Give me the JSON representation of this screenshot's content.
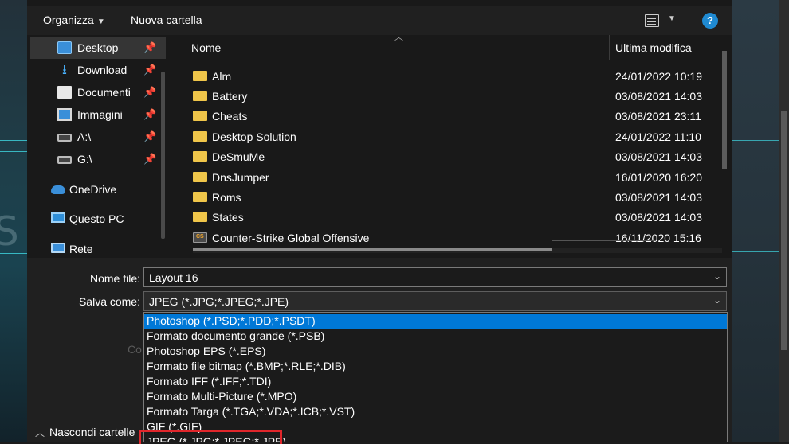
{
  "toolbar": {
    "organize_label": "Organizza",
    "new_folder_label": "Nuova cartella"
  },
  "nav": {
    "items": [
      {
        "label": "Desktop",
        "icon": "desktop-icon",
        "pinned": true
      },
      {
        "label": "Download",
        "icon": "download-icon",
        "pinned": true
      },
      {
        "label": "Documenti",
        "icon": "documents-icon",
        "pinned": true
      },
      {
        "label": "Immagini",
        "icon": "pictures-icon",
        "pinned": true
      },
      {
        "label": "A:\\",
        "icon": "drive-icon",
        "pinned": true
      },
      {
        "label": "G:\\",
        "icon": "drive-icon",
        "pinned": true
      },
      {
        "label": "OneDrive",
        "icon": "onedrive-icon",
        "pinned": false
      },
      {
        "label": "Questo PC",
        "icon": "this-pc-icon",
        "pinned": false
      },
      {
        "label": "Rete",
        "icon": "network-icon",
        "pinned": false
      }
    ]
  },
  "files": {
    "columns": {
      "name": "Nome",
      "modified": "Ultima modifica"
    },
    "rows": [
      {
        "name": "Alm",
        "modified": "24/01/2022 10:19",
        "type": "folder"
      },
      {
        "name": "Battery",
        "modified": "03/08/2021 14:03",
        "type": "folder"
      },
      {
        "name": "Cheats",
        "modified": "03/08/2021 23:11",
        "type": "folder"
      },
      {
        "name": "Desktop Solution",
        "modified": "24/01/2022 11:10",
        "type": "folder"
      },
      {
        "name": "DeSmuMe",
        "modified": "03/08/2021 14:03",
        "type": "folder"
      },
      {
        "name": "DnsJumper",
        "modified": "16/01/2020 16:20",
        "type": "folder"
      },
      {
        "name": "Roms",
        "modified": "03/08/2021 14:03",
        "type": "folder"
      },
      {
        "name": "States",
        "modified": "03/08/2021 14:03",
        "type": "folder"
      },
      {
        "name": "Counter-Strike Global Offensive",
        "modified": "16/11/2020 15:16",
        "type": "shortcut"
      }
    ]
  },
  "form": {
    "filename_label": "Nome file:",
    "filename_value": "Layout 16",
    "saveas_label": "Salva come:",
    "saveas_value": "JPEG (*.JPG;*.JPEG;*.JPE)",
    "faded_text": "Co",
    "hide_folders_label": "Nascondi cartelle"
  },
  "dropdown": {
    "options": [
      "Photoshop (*.PSD;*.PDD;*.PSDT)",
      "Formato documento grande (*.PSB)",
      "Photoshop EPS (*.EPS)",
      "Formato file bitmap (*.BMP;*.RLE;*.DIB)",
      "Formato IFF (*.IFF;*.TDI)",
      "Formato Multi-Picture (*.MPO)",
      "Formato Targa (*.TGA;*.VDA;*.ICB;*.VST)",
      "GIF (*.GIF)",
      "JPEG (*.JPG;*.JPEG;*.JPE)"
    ],
    "highlighted_index": 0,
    "highlight_color": "#0078d7",
    "callout_color": "#e0262b"
  }
}
